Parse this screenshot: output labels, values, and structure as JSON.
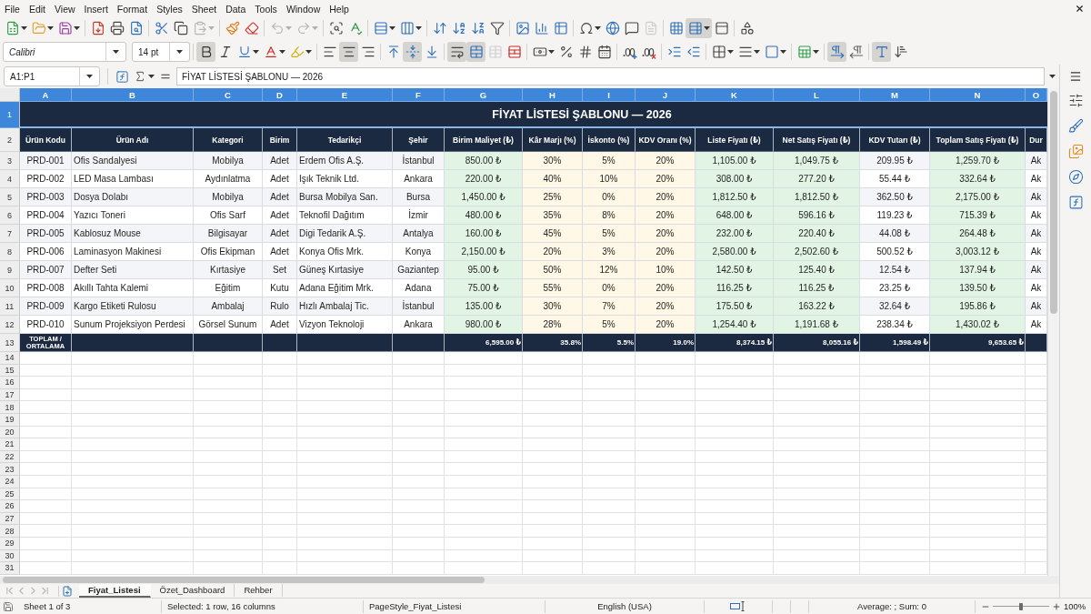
{
  "menu_bar": [
    "File",
    "Edit",
    "View",
    "Insert",
    "Format",
    "Styles",
    "Sheet",
    "Data",
    "Tools",
    "Window",
    "Help"
  ],
  "standard_toolbar": [
    [
      {
        "kind": "new",
        "dropdown": true,
        "active": false,
        "disabled": false
      },
      {
        "kind": "open",
        "dropdown": true,
        "active": false,
        "disabled": false
      },
      {
        "kind": "save",
        "dropdown": true,
        "active": false,
        "disabled": false
      }
    ],
    [
      {
        "kind": "pdf",
        "dropdown": false,
        "active": false,
        "disabled": false
      },
      {
        "kind": "print",
        "dropdown": false,
        "active": false,
        "disabled": false
      },
      {
        "kind": "preview",
        "dropdown": false,
        "active": false,
        "disabled": false
      }
    ],
    [
      {
        "kind": "cut",
        "dropdown": false,
        "active": false,
        "disabled": false
      },
      {
        "kind": "copy",
        "dropdown": false,
        "active": false,
        "disabled": false
      },
      {
        "kind": "paste",
        "dropdown": true,
        "active": false,
        "disabled": true
      }
    ],
    [
      {
        "kind": "clone",
        "dropdown": false,
        "active": false,
        "disabled": false
      },
      {
        "kind": "clear",
        "dropdown": false,
        "active": false,
        "disabled": false
      }
    ],
    [
      {
        "kind": "undo",
        "dropdown": true,
        "active": false,
        "disabled": true
      },
      {
        "kind": "redo",
        "dropdown": true,
        "active": false,
        "disabled": true
      }
    ],
    [
      {
        "kind": "find",
        "dropdown": false,
        "active": false,
        "disabled": false
      },
      {
        "kind": "spelling",
        "dropdown": false,
        "active": false,
        "disabled": false
      }
    ],
    [
      {
        "kind": "rows",
        "dropdown": true,
        "active": false,
        "disabled": false
      },
      {
        "kind": "columns",
        "dropdown": true,
        "active": false,
        "disabled": false
      }
    ],
    [
      {
        "kind": "sort",
        "dropdown": false,
        "active": false,
        "disabled": false
      },
      {
        "kind": "ascending",
        "dropdown": false,
        "active": false,
        "disabled": false
      },
      {
        "kind": "descending",
        "dropdown": false,
        "active": false,
        "disabled": false
      },
      {
        "kind": "filter",
        "dropdown": false,
        "active": false,
        "disabled": false
      }
    ],
    [
      {
        "kind": "image",
        "dropdown": false,
        "active": false,
        "disabled": false
      },
      {
        "kind": "chart",
        "dropdown": false,
        "active": false,
        "disabled": false
      },
      {
        "kind": "pivot",
        "dropdown": false,
        "active": false,
        "disabled": false
      }
    ],
    [
      {
        "kind": "special",
        "dropdown": true,
        "active": false,
        "disabled": false
      },
      {
        "kind": "hyperlink",
        "dropdown": false,
        "active": false,
        "disabled": false
      },
      {
        "kind": "comment",
        "dropdown": false,
        "active": false,
        "disabled": false
      },
      {
        "kind": "headerfooter",
        "dropdown": false,
        "active": false,
        "disabled": true
      }
    ],
    [
      {
        "kind": "printarea",
        "dropdown": false,
        "active": false,
        "disabled": false
      },
      {
        "kind": "freeze",
        "dropdown": true,
        "active": true,
        "disabled": false
      },
      {
        "kind": "split",
        "dropdown": false,
        "active": false,
        "disabled": false
      }
    ],
    [
      {
        "kind": "draw",
        "dropdown": false,
        "active": false,
        "disabled": false
      }
    ]
  ],
  "formatting_toolbar": {
    "font_name": "Calibri",
    "font_size": "14 pt",
    "groups": [
      [
        {
          "kind": "bold",
          "dropdown": false,
          "active": true,
          "disabled": false
        },
        {
          "kind": "italic",
          "dropdown": false,
          "active": false,
          "disabled": false
        },
        {
          "kind": "underline",
          "dropdown": true,
          "active": false,
          "disabled": false
        },
        {
          "kind": "fontcolor",
          "dropdown": true,
          "active": false,
          "disabled": false
        },
        {
          "kind": "highlight",
          "dropdown": true,
          "active": false,
          "disabled": false
        }
      ],
      [
        {
          "kind": "left",
          "dropdown": false,
          "active": false,
          "disabled": false
        },
        {
          "kind": "center",
          "dropdown": false,
          "active": true,
          "disabled": false
        },
        {
          "kind": "right",
          "dropdown": false,
          "active": false,
          "disabled": false
        }
      ],
      [
        {
          "kind": "top",
          "dropdown": false,
          "active": false,
          "disabled": false
        },
        {
          "kind": "middle",
          "dropdown": false,
          "active": true,
          "disabled": false
        },
        {
          "kind": "bottom",
          "dropdown": false,
          "active": false,
          "disabled": false
        }
      ],
      [
        {
          "kind": "wrap",
          "dropdown": false,
          "active": true,
          "disabled": false
        },
        {
          "kind": "mergecenter",
          "dropdown": false,
          "active": true,
          "disabled": false
        },
        {
          "kind": "merge",
          "dropdown": false,
          "active": false,
          "disabled": true
        },
        {
          "kind": "unmerge",
          "dropdown": false,
          "active": false,
          "disabled": false
        }
      ],
      [
        {
          "kind": "currency",
          "dropdown": true,
          "active": false,
          "disabled": false
        },
        {
          "kind": "percent",
          "dropdown": false,
          "active": false,
          "disabled": false
        },
        {
          "kind": "number",
          "dropdown": false,
          "active": false,
          "disabled": false
        },
        {
          "kind": "date",
          "dropdown": false,
          "active": false,
          "disabled": false
        }
      ],
      [
        {
          "kind": "adddecimal",
          "dropdown": false,
          "active": false,
          "disabled": false
        },
        {
          "kind": "deldecimal",
          "dropdown": false,
          "active": false,
          "disabled": false
        }
      ],
      [
        {
          "kind": "indent",
          "dropdown": false,
          "active": false,
          "disabled": false
        },
        {
          "kind": "outdent",
          "dropdown": false,
          "active": false,
          "disabled": false
        }
      ],
      [
        {
          "kind": "borders",
          "dropdown": true,
          "active": false,
          "disabled": false
        },
        {
          "kind": "borderstyle",
          "dropdown": true,
          "active": false,
          "disabled": false
        },
        {
          "kind": "bordercolor",
          "dropdown": true,
          "active": false,
          "disabled": false
        }
      ],
      [
        {
          "kind": "conditional",
          "dropdown": true,
          "active": false,
          "disabled": false
        }
      ],
      [
        {
          "kind": "ltr",
          "dropdown": false,
          "active": true,
          "disabled": false
        },
        {
          "kind": "rtl",
          "dropdown": false,
          "active": false,
          "disabled": false
        }
      ],
      [
        {
          "kind": "horizontal",
          "dropdown": false,
          "active": true,
          "disabled": false
        },
        {
          "kind": "vertical",
          "dropdown": false,
          "active": false,
          "disabled": false
        }
      ]
    ]
  },
  "formula_bar": {
    "name_box": "A1:P1",
    "formula": "FİYAT LİSTESİ ŞABLONU — 2026"
  },
  "sheet": {
    "column_headers": [
      {
        "label": "A",
        "selected": true
      },
      {
        "label": "B",
        "selected": true
      },
      {
        "label": "C",
        "selected": true
      },
      {
        "label": "D",
        "selected": true
      },
      {
        "label": "E",
        "selected": true
      },
      {
        "label": "F",
        "selected": true
      },
      {
        "label": "G",
        "selected": true
      },
      {
        "label": "H",
        "selected": true
      },
      {
        "label": "I",
        "selected": true
      },
      {
        "label": "J",
        "selected": true
      },
      {
        "label": "K",
        "selected": true
      },
      {
        "label": "L",
        "selected": true
      },
      {
        "label": "M",
        "selected": true
      },
      {
        "label": "N",
        "selected": true
      },
      {
        "label": "O",
        "selected": true
      }
    ],
    "title_row": {
      "row": "1",
      "selected": true,
      "text": "FİYAT LİSTESİ ŞABLONU — 2026"
    },
    "header_row": {
      "row": "2",
      "selected": false,
      "cells": [
        "Ürün Kodu",
        "Ürün Adı",
        "Kategori",
        "Birim",
        "Tedarikçi",
        "Şehir",
        "Birim Maliyet (₺)",
        "Kâr Marjı (%)",
        "İskonto (%)",
        "KDV Oranı (%)",
        "Liste Fiyatı (₺)",
        "Net Satış Fiyatı (₺)",
        "KDV Tutarı (₺)",
        "Toplam Satış Fiyatı (₺)",
        "Dur"
      ]
    },
    "data_rows": [
      {
        "row": "3",
        "selected": false,
        "cells": [
          "PRD-001",
          "Ofis Sandalyesi",
          "Mobilya",
          "Adet",
          "Erdem Ofis A.Ş.",
          "İstanbul",
          "850.00 ₺",
          "30%",
          "5%",
          "20%",
          "1,105.00 ₺",
          "1,049.75 ₺",
          "209.95 ₺",
          "1,259.70 ₺",
          "Ak"
        ]
      },
      {
        "row": "4",
        "selected": false,
        "cells": [
          "PRD-002",
          "LED Masa Lambası",
          "Aydınlatma",
          "Adet",
          "Işık Teknik Ltd.",
          "Ankara",
          "220.00 ₺",
          "40%",
          "10%",
          "20%",
          "308.00 ₺",
          "277.20 ₺",
          "55.44 ₺",
          "332.64 ₺",
          "Ak"
        ]
      },
      {
        "row": "5",
        "selected": false,
        "cells": [
          "PRD-003",
          "Dosya Dolabı",
          "Mobilya",
          "Adet",
          "Bursa Mobilya San.",
          "Bursa",
          "1,450.00 ₺",
          "25%",
          "0%",
          "20%",
          "1,812.50 ₺",
          "1,812.50 ₺",
          "362.50 ₺",
          "2,175.00 ₺",
          "Ak"
        ]
      },
      {
        "row": "6",
        "selected": false,
        "cells": [
          "PRD-004",
          "Yazıcı Toneri",
          "Ofis Sarf",
          "Adet",
          "Teknofil Dağıtım",
          "İzmir",
          "480.00 ₺",
          "35%",
          "8%",
          "20%",
          "648.00 ₺",
          "596.16 ₺",
          "119.23 ₺",
          "715.39 ₺",
          "Ak"
        ]
      },
      {
        "row": "7",
        "selected": false,
        "cells": [
          "PRD-005",
          "Kablosuz Mouse",
          "Bilgisayar",
          "Adet",
          "Digi Tedarik A.Ş.",
          "Antalya",
          "160.00 ₺",
          "45%",
          "5%",
          "20%",
          "232.00 ₺",
          "220.40 ₺",
          "44.08 ₺",
          "264.48 ₺",
          "Ak"
        ]
      },
      {
        "row": "8",
        "selected": false,
        "cells": [
          "PRD-006",
          "Laminasyon Makinesi",
          "Ofis Ekipman",
          "Adet",
          "Konya Ofis Mrk.",
          "Konya",
          "2,150.00 ₺",
          "20%",
          "3%",
          "20%",
          "2,580.00 ₺",
          "2,502.60 ₺",
          "500.52 ₺",
          "3,003.12 ₺",
          "Ak"
        ]
      },
      {
        "row": "9",
        "selected": false,
        "cells": [
          "PRD-007",
          "Defter Seti",
          "Kırtasiye",
          "Set",
          "Güneş Kırtasiye",
          "Gaziantep",
          "95.00 ₺",
          "50%",
          "12%",
          "10%",
          "142.50 ₺",
          "125.40 ₺",
          "12.54 ₺",
          "137.94 ₺",
          "Ak"
        ]
      },
      {
        "row": "10",
        "selected": false,
        "cells": [
          "PRD-008",
          "Akıllı Tahta Kalemi",
          "Eğitim",
          "Kutu",
          "Adana Eğitim Mrk.",
          "Adana",
          "75.00 ₺",
          "55%",
          "0%",
          "20%",
          "116.25 ₺",
          "116.25 ₺",
          "23.25 ₺",
          "139.50 ₺",
          "Ak"
        ]
      },
      {
        "row": "11",
        "selected": false,
        "cells": [
          "PRD-009",
          "Kargo Etiketi Rulosu",
          "Ambalaj",
          "Rulo",
          "Hızlı Ambalaj Tic.",
          "İstanbul",
          "135.00 ₺",
          "30%",
          "7%",
          "20%",
          "175.50 ₺",
          "163.22 ₺",
          "32.64 ₺",
          "195.86 ₺",
          "Ak"
        ]
      },
      {
        "row": "12",
        "selected": false,
        "cells": [
          "PRD-010",
          "Sunum Projeksiyon Perdesi",
          "Görsel Sunum",
          "Adet",
          "Vizyon Teknoloji",
          "Ankara",
          "980.00 ₺",
          "28%",
          "5%",
          "20%",
          "1,254.40 ₺",
          "1,191.68 ₺",
          "238.34 ₺",
          "1,430.02 ₺",
          "Ak"
        ]
      }
    ],
    "total_row": {
      "row": "13",
      "selected": false,
      "label": "TOPLAM / ORTALAMA",
      "values": [
        "6,595.00 ₺",
        "35.8%",
        "5.5%",
        "19.0%",
        "8,374.15 ₺",
        "8,055.16 ₺",
        "1,598.49 ₺",
        "9,653.65 ₺"
      ]
    },
    "empty_rows": [
      {
        "row": "14",
        "selected": false
      },
      {
        "row": "15",
        "selected": false
      },
      {
        "row": "16",
        "selected": false
      },
      {
        "row": "17",
        "selected": false
      },
      {
        "row": "18",
        "selected": false
      },
      {
        "row": "19",
        "selected": false
      },
      {
        "row": "20",
        "selected": false
      },
      {
        "row": "21",
        "selected": false
      },
      {
        "row": "22",
        "selected": false
      },
      {
        "row": "23",
        "selected": false
      },
      {
        "row": "24",
        "selected": false
      },
      {
        "row": "25",
        "selected": false
      },
      {
        "row": "26",
        "selected": false
      },
      {
        "row": "27",
        "selected": false
      },
      {
        "row": "28",
        "selected": false
      },
      {
        "row": "29",
        "selected": false
      },
      {
        "row": "30",
        "selected": false
      },
      {
        "row": "31",
        "selected": false
      }
    ]
  },
  "sheet_tabs": [
    {
      "label": "Fiyat_Listesi",
      "selected": true
    },
    {
      "label": "Özet_Dashboard",
      "selected": false
    },
    {
      "label": "Rehber",
      "selected": false
    }
  ],
  "status_bar": {
    "sheet_position": "Sheet 1 of 3",
    "selection": "Selected: 1 row, 16 columns",
    "page_style": "PageStyle_Fiyat_Listesi",
    "language": "English (USA)",
    "summary": "Average: ; Sum: 0",
    "zoom": {
      "level": 0.5,
      "percent": "100%"
    }
  }
}
